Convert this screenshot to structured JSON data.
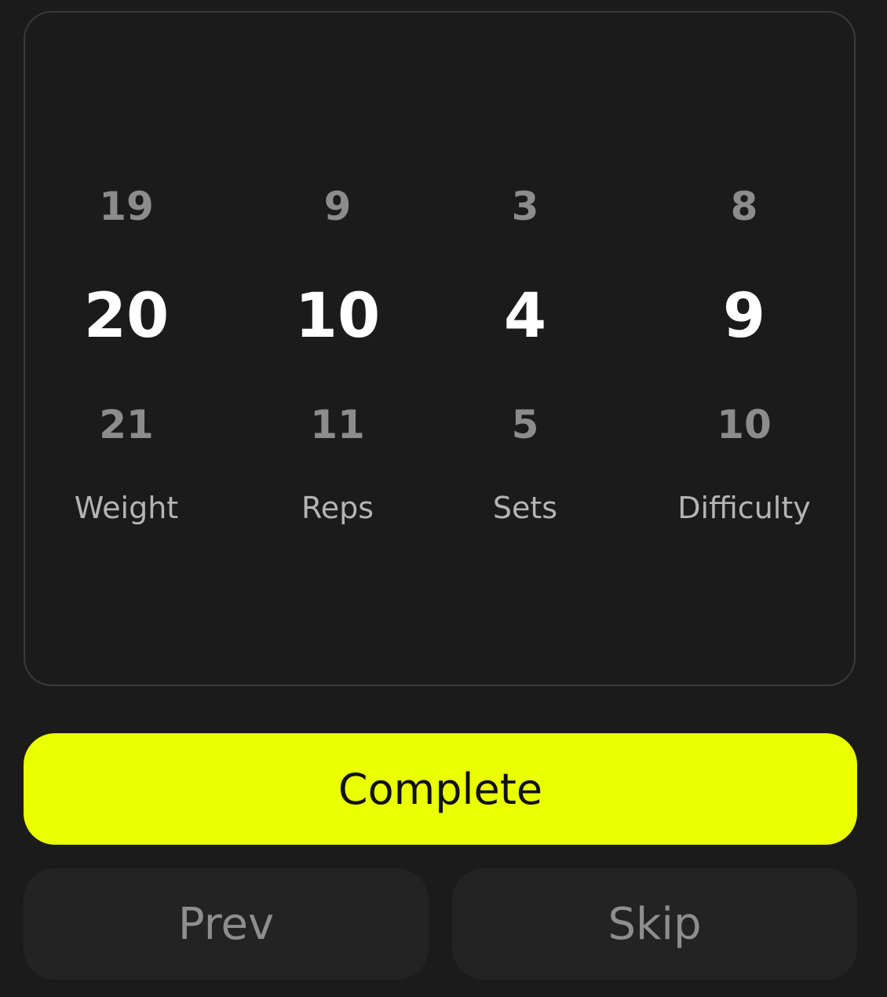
{
  "pickers": [
    {
      "label": "Weight",
      "prev": "19",
      "current": "20",
      "next": "21"
    },
    {
      "label": "Reps",
      "prev": "9",
      "current": "10",
      "next": "11"
    },
    {
      "label": "Sets",
      "prev": "3",
      "current": "4",
      "next": "5"
    },
    {
      "label": "Difficulty",
      "prev": "8",
      "current": "9",
      "next": "10"
    }
  ],
  "actions": {
    "complete_label": "Complete",
    "prev_label": "Prev",
    "skip_label": "Skip"
  },
  "colors": {
    "background": "#1b1b1b",
    "accent": "#eaff00",
    "secondary_button": "#232323",
    "muted_text": "#8c8c8c"
  }
}
